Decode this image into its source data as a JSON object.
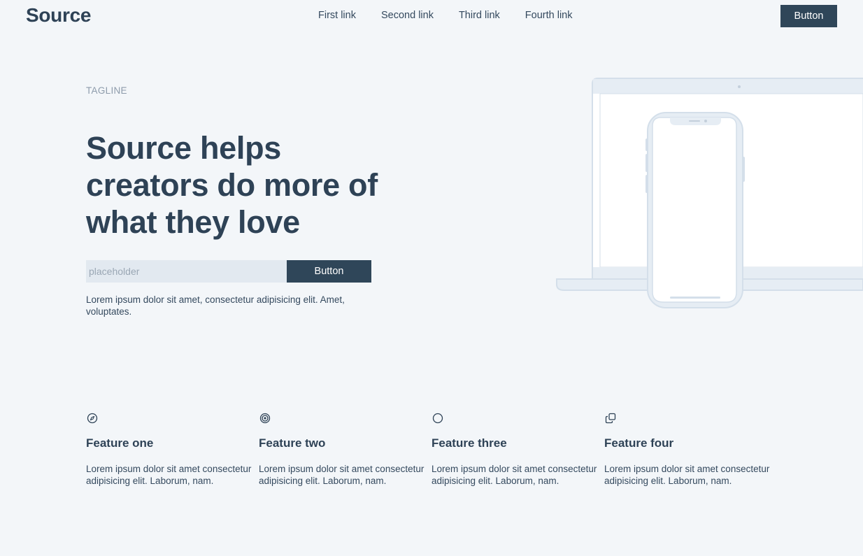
{
  "header": {
    "logo": "Source",
    "nav": [
      "First link",
      "Second link",
      "Third link",
      "Fourth link"
    ],
    "button_label": "Button"
  },
  "hero": {
    "tagline": "TAGLINE",
    "title": "Source helps creators do more of what they love",
    "input_placeholder": "placeholder",
    "button_label": "Button",
    "description": "Lorem ipsum dolor sit amet, consectetur adipisicing elit. Amet, voluptates."
  },
  "illustration": {
    "laptop_icon": "laptop-illustration",
    "phone_icon": "phone-illustration"
  },
  "features": [
    {
      "icon": "compass-icon",
      "title": "Feature one",
      "text": "Lorem ipsum dolor sit amet consectetur adipisicing elit. Laborum, nam."
    },
    {
      "icon": "target-icon",
      "title": "Feature two",
      "text": "Lorem ipsum dolor sit amet consectetur adipisicing elit. Laborum, nam."
    },
    {
      "icon": "circle-icon",
      "title": "Feature three",
      "text": "Lorem ipsum dolor sit amet consectetur adipisicing elit. Laborum, nam."
    },
    {
      "icon": "copy-icon",
      "title": "Feature four",
      "text": "Lorem ipsum dolor sit amet consectetur adipisicing elit. Laborum, nam."
    }
  ],
  "colors": {
    "background": "#f3f6f9",
    "primary": "#2f4659",
    "text": "#2e4256",
    "muted": "#8d9bab",
    "input_bg": "#e2e9f0",
    "device_outline": "#d4dfea"
  }
}
